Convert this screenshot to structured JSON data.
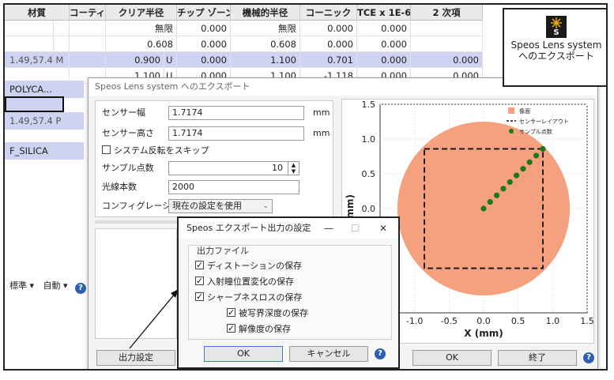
{
  "grid": {
    "headers": [
      "材質",
      "コーティン",
      "クリア半径",
      "チップ ゾーン",
      "機械的半径",
      "コーニック",
      "TCE x 1E-6",
      "2 次項"
    ],
    "rows": [
      {
        "clear": "無限",
        "cflag": "",
        "chip": "0.000",
        "mech": "無限",
        "conic": "0.000",
        "tce": "0.000",
        "second": ""
      },
      {
        "clear": "0.608",
        "cflag": "",
        "chip": "0.000",
        "mech": "0.608",
        "conic": "0.000",
        "tce": "0.000",
        "second": ""
      },
      {
        "clear": "0.900",
        "cflag": "U",
        "chip": "0.000",
        "mech": "1.100",
        "conic": "0.701",
        "tce": "0.000",
        "second": "0.000"
      },
      {
        "clear": "1.100",
        "cflag": "U",
        "chip": "0.000",
        "mech": "1.100",
        "conic": "-1.118",
        "tce": "0.000",
        "second": "0.000"
      }
    ],
    "materials": [
      "1.49,57.4 M",
      "POLYCA...",
      "",
      "1.49,57.4  P",
      "F_SILICA"
    ],
    "footer_tools": [
      "標準 ▾",
      "自動 ▾"
    ]
  },
  "speos_button": {
    "label_line1": "Speos Lens system",
    "label_line2": "へのエクスポート",
    "icon_letter": "S"
  },
  "dialog": {
    "title": "Speos Lens system へのエクスポート",
    "sensor_width_label": "センサー幅",
    "sensor_width": "1.7174",
    "sensor_height_label": "センサー高さ",
    "sensor_height": "1.7174",
    "unit": "mm",
    "skip_reverse_label": "システム反転をスキップ",
    "sample_points_label": "サンプル点数",
    "sample_points": "10",
    "rays_label": "光線本数",
    "rays": "2000",
    "config_label": "コンフィグレーション",
    "config_value": "現在の設定を使用",
    "output_settings_button": "出力設定",
    "ok_button": "OK",
    "close_button": "終了"
  },
  "subdialog": {
    "title": "Speos エクスポート出力の設定",
    "group_label": "出力ファイル",
    "items": [
      {
        "label": "ディストーションの保存",
        "checked": true
      },
      {
        "label": "入射瞳位置変化の保存",
        "checked": true
      },
      {
        "label": "シャープネスロスの保存",
        "checked": true
      },
      {
        "label": "被写界深度の保存",
        "checked": true
      },
      {
        "label": "解像度の保存",
        "checked": true
      }
    ],
    "ok_button": "OK",
    "cancel_button": "キャンセル",
    "minimize": "—",
    "maximize": "☐",
    "close": "✕"
  },
  "chart_data": {
    "type": "scatter",
    "xlabel": "X (mm)",
    "ylabel": "(mm)",
    "xlim": [
      -1.5,
      1.5
    ],
    "ylim": [
      -1.5,
      1.5
    ],
    "x_ticks": [
      "-1.0",
      "-0.5",
      "0.0",
      "0.5",
      "1.0",
      "1.5"
    ],
    "y_ticks": [
      "1.5",
      "1.0",
      "0.5",
      "0.0"
    ],
    "grid": true,
    "legend_placement": "top-right",
    "legend": [
      "像面",
      "センサーレイアウト",
      "サンプル点数"
    ],
    "image_circle": {
      "cx": 0.0,
      "cy": 0.0,
      "r": 1.25,
      "color": "#f5a07f"
    },
    "sensor_layout": {
      "x": [
        -0.8587,
        0.8587,
        0.8587,
        -0.8587,
        -0.8587
      ],
      "y": [
        0.8587,
        0.8587,
        -0.8587,
        -0.8587,
        0.8587
      ]
    },
    "samples": {
      "x": [
        0.0,
        0.095,
        0.19,
        0.286,
        0.381,
        0.476,
        0.572,
        0.667,
        0.762,
        0.858
      ],
      "y": [
        0.0,
        0.095,
        0.19,
        0.286,
        0.381,
        0.476,
        0.572,
        0.667,
        0.762,
        0.858
      ],
      "color": "#1a7a1a"
    }
  }
}
